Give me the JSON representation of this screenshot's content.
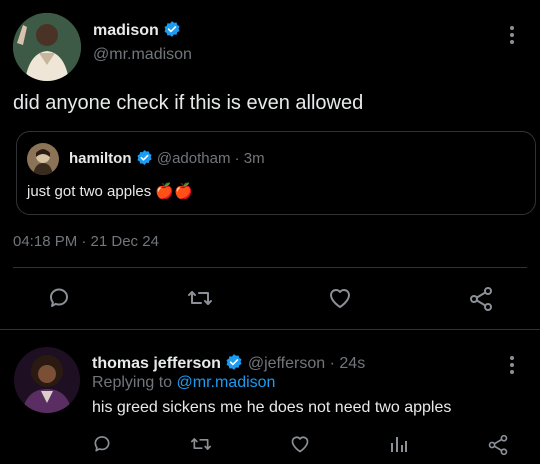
{
  "main_tweet": {
    "display_name": "madison",
    "handle": "@mr.madison",
    "text": "did anyone check if this is even allowed",
    "timestamp": "04:18 PM · 21 Dec 24"
  },
  "quoted_tweet": {
    "display_name": "hamilton",
    "handle": "@adotham",
    "separator": "·",
    "time": "3m",
    "text": "just got two apples",
    "emoji": "🍎🍎"
  },
  "reply_tweet": {
    "display_name": "thomas jefferson",
    "handle": "@jefferson",
    "separator": "·",
    "time": "24s",
    "replying_prefix": "Replying to",
    "replying_handle": "@mr.madison",
    "text": "his greed sickens me he does not need two apples"
  },
  "icons": {
    "verified": "verified-badge-icon",
    "reply": "reply-icon",
    "retweet": "retweet-icon",
    "like": "heart-icon",
    "views": "analytics-icon",
    "share": "share-icon",
    "more": "more-options-icon"
  },
  "colors": {
    "background": "#000000",
    "accent": "#1d9bf0",
    "text": "#e7e9ea",
    "muted": "#71767b",
    "border": "#2f3336"
  }
}
